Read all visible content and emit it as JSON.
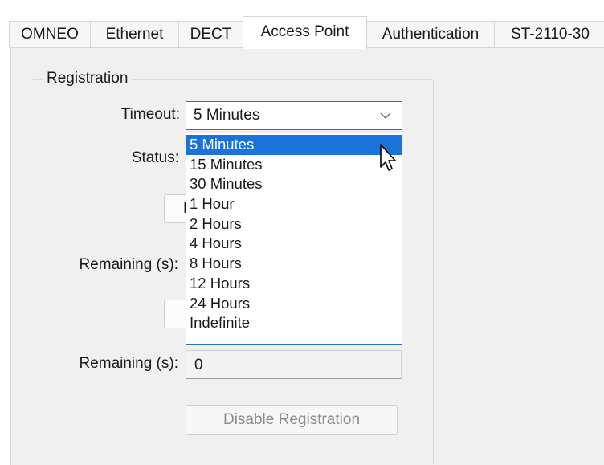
{
  "tabs": [
    {
      "label": "OMNEO",
      "active": false
    },
    {
      "label": "Ethernet",
      "active": false
    },
    {
      "label": "DECT",
      "active": false
    },
    {
      "label": "Access Point",
      "active": true
    },
    {
      "label": "Authentication",
      "active": false
    },
    {
      "label": "ST-2110-30",
      "active": false
    }
  ],
  "registration": {
    "group_title": "Registration",
    "timeout_label": "Timeout:",
    "timeout_value": "5 Minutes",
    "status_label": "Status:",
    "enable_button_partial": "E",
    "remaining_label_1": "Remaining (s):",
    "remaining_label_2": "Remaining (s):",
    "remaining_value": "0",
    "disable_button": "Disable Registration"
  },
  "timeout_options": [
    "5 Minutes",
    "15 Minutes",
    "30 Minutes",
    "1 Hour",
    "2 Hours",
    "4 Hours",
    "8 Hours",
    "12 Hours",
    "24 Hours",
    "Indefinite"
  ],
  "selected_option": "5 Minutes",
  "colors": {
    "accent": "#1a73d9",
    "focus_border": "#2a6fc9",
    "panel_bg": "#f0f0f0"
  }
}
